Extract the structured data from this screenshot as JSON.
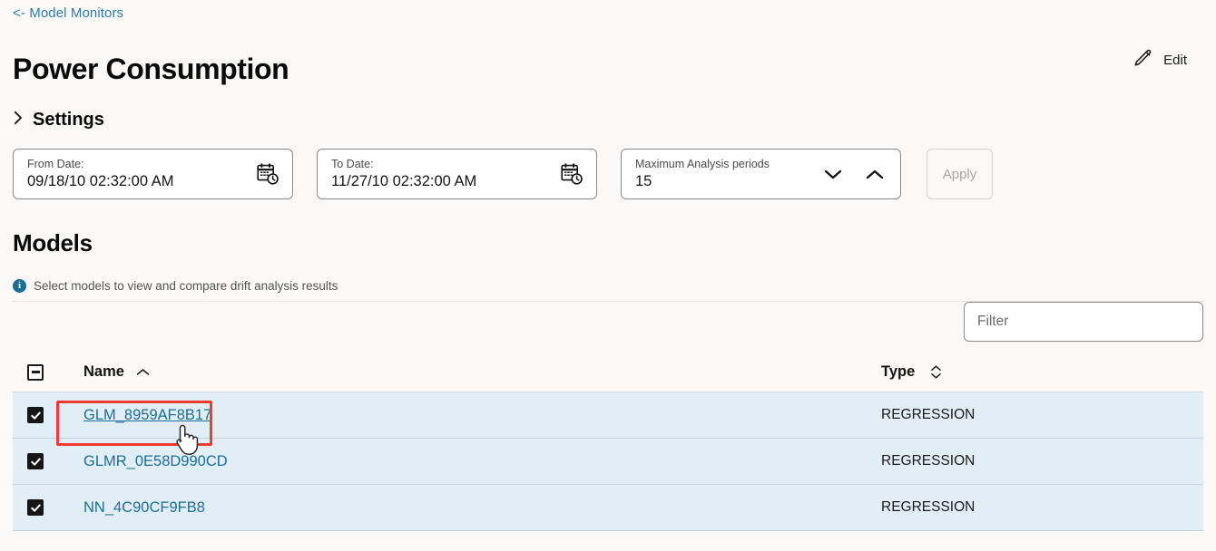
{
  "breadcrumb": {
    "label": "<- Model Monitors"
  },
  "header": {
    "title": "Power Consumption",
    "edit_label": "Edit",
    "edit_icon": "pencil-icon"
  },
  "settings": {
    "title": "Settings",
    "chevron_icon": "chevron-right-icon",
    "from_date": {
      "label": "From Date:",
      "value": "09/18/10 02:32:00 AM",
      "icon": "calendar-clock-icon"
    },
    "to_date": {
      "label": "To Date:",
      "value": "11/27/10 02:32:00 AM",
      "icon": "calendar-clock-icon"
    },
    "periods": {
      "label": "Maximum Analysis periods",
      "value": "15",
      "decrement_icon": "chevron-down-icon",
      "increment_icon": "chevron-up-icon"
    },
    "apply_label": "Apply",
    "apply_disabled": true
  },
  "models": {
    "title": "Models",
    "hint": "Select models to view and compare drift analysis results",
    "info_icon": "info-icon",
    "info_icon_color": "#1a6e94",
    "filter": {
      "placeholder": "Filter",
      "value": ""
    },
    "table": {
      "select_all_state": "indeterminate",
      "columns": [
        {
          "key": "name",
          "label": "Name",
          "sort": "asc",
          "sort_icon": "chevron-up-icon"
        },
        {
          "key": "type",
          "label": "Type",
          "sort": "none",
          "sort_icon": "sort-updown-icon"
        }
      ],
      "rows": [
        {
          "checked": true,
          "name": "GLM_8959AF8B17",
          "type": "REGRESSION",
          "highlighted": true
        },
        {
          "checked": true,
          "name": "GLMR_0E58D990CD",
          "type": "REGRESSION",
          "highlighted": false
        },
        {
          "checked": true,
          "name": "NN_4C90CF9FB8",
          "type": "REGRESSION",
          "highlighted": false
        }
      ]
    }
  },
  "annotation": {
    "box_color": "#ef3b33",
    "cursor_icon": "pointing-hand-cursor"
  },
  "colors": {
    "link": "#1a6e94",
    "page_background": "#faf9f7",
    "selected_row": "#e2eef6"
  }
}
